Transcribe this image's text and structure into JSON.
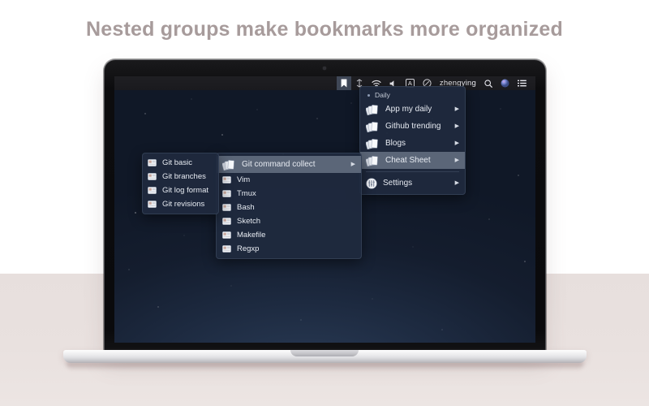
{
  "headline": "Nested groups make bookmarks more organized",
  "colors": {
    "page_top": "#ffffff",
    "page_bottom": "#e7dfdd",
    "headline_text": "#a79b9b",
    "menubar_bg": "#1f1f23",
    "menu_bg": "#1f2a3e",
    "menu_text": "#e7ebf2",
    "menu_highlight": "#5b6678",
    "menubar_active": "#3f4756",
    "wallpaper": "#141d2e",
    "laptop_body": "#0a0a0c",
    "laptop_deck": "#f2f2f3"
  },
  "menubar": {
    "items": [
      {
        "name": "bookmark-icon",
        "label": "",
        "active": true
      },
      {
        "name": "dropbox-icon",
        "label": "",
        "active": false
      },
      {
        "name": "wifi-icon",
        "label": "",
        "active": false
      },
      {
        "name": "volume-icon",
        "label": "",
        "active": false
      },
      {
        "name": "input-source-icon",
        "label": "A",
        "active": false
      },
      {
        "name": "timer-icon",
        "label": "",
        "active": false
      },
      {
        "name": "user-name",
        "label": "zhengying",
        "active": false
      },
      {
        "name": "spotlight-search-icon",
        "label": "",
        "active": false
      },
      {
        "name": "siri-icon",
        "label": "",
        "active": false
      },
      {
        "name": "notification-center-icon",
        "label": "",
        "active": false
      }
    ],
    "user": "zhengying",
    "input_source": "A"
  },
  "menus": {
    "daily": {
      "header": "Daily",
      "items": [
        {
          "label": "App my daily",
          "icon": "cards-icon",
          "submenu": true,
          "selected": false
        },
        {
          "label": "Github trending",
          "icon": "cards-icon",
          "submenu": true,
          "selected": false
        },
        {
          "label": "Blogs",
          "icon": "cards-icon",
          "submenu": true,
          "selected": false
        },
        {
          "label": "Cheat Sheet",
          "icon": "cards-icon",
          "submenu": true,
          "selected": true
        }
      ],
      "footer": [
        {
          "label": "Settings",
          "icon": "settings-icon",
          "submenu": true,
          "selected": false
        }
      ]
    },
    "cheat_sheet": {
      "items": [
        {
          "label": "Git command collect",
          "icon": "cards-icon",
          "submenu": true,
          "selected": true
        },
        {
          "label": "Vim",
          "icon": "card-icon",
          "submenu": false,
          "selected": false
        },
        {
          "label": "Tmux",
          "icon": "card-icon",
          "submenu": false,
          "selected": false
        },
        {
          "label": "Bash",
          "icon": "card-icon",
          "submenu": false,
          "selected": false
        },
        {
          "label": "Sketch",
          "icon": "card-icon",
          "submenu": false,
          "selected": false
        },
        {
          "label": "Makefile",
          "icon": "card-icon",
          "submenu": false,
          "selected": false
        },
        {
          "label": "Regxp",
          "icon": "card-icon",
          "submenu": false,
          "selected": false
        }
      ]
    },
    "git_command_collect": {
      "items": [
        {
          "label": "Git basic",
          "icon": "card-icon",
          "submenu": false,
          "selected": false
        },
        {
          "label": "Git branches",
          "icon": "card-icon",
          "submenu": false,
          "selected": false
        },
        {
          "label": "Git log format",
          "icon": "card-icon",
          "submenu": false,
          "selected": false
        },
        {
          "label": "Git revisions",
          "icon": "card-icon",
          "submenu": false,
          "selected": false
        }
      ]
    }
  },
  "caret_glyph": "▶"
}
